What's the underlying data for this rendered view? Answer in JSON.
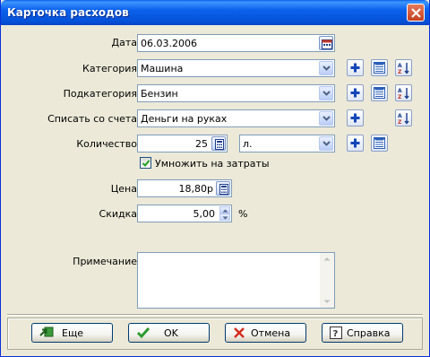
{
  "window": {
    "title": "Карточка расходов"
  },
  "form": {
    "date_label": "Дата",
    "date_value": "06.03.2006",
    "category_label": "Категория",
    "category_value": "Машина",
    "subcategory_label": "Подкатегория",
    "subcategory_value": "Бензин",
    "account_label": "Списать со счета",
    "account_value": "Деньги на руках",
    "quantity_label": "Количество",
    "quantity_value": "25",
    "unit_value": "л.",
    "multiply_label": "Умножить на затраты",
    "multiply_checked": true,
    "price_label": "Цена",
    "price_value": "18,80р",
    "discount_label": "Скидка",
    "discount_value": "5,00",
    "discount_unit": "%",
    "note_label": "Примечание",
    "note_value": ""
  },
  "buttons": {
    "more": "Еще",
    "ok": "OK",
    "cancel": "Отмена",
    "help": "Справка"
  },
  "icons": {
    "add": "plus-icon",
    "list": "list-icon",
    "sort": "sort-az-icon",
    "calendar": "calendar-icon",
    "calculator": "calculator-icon"
  }
}
